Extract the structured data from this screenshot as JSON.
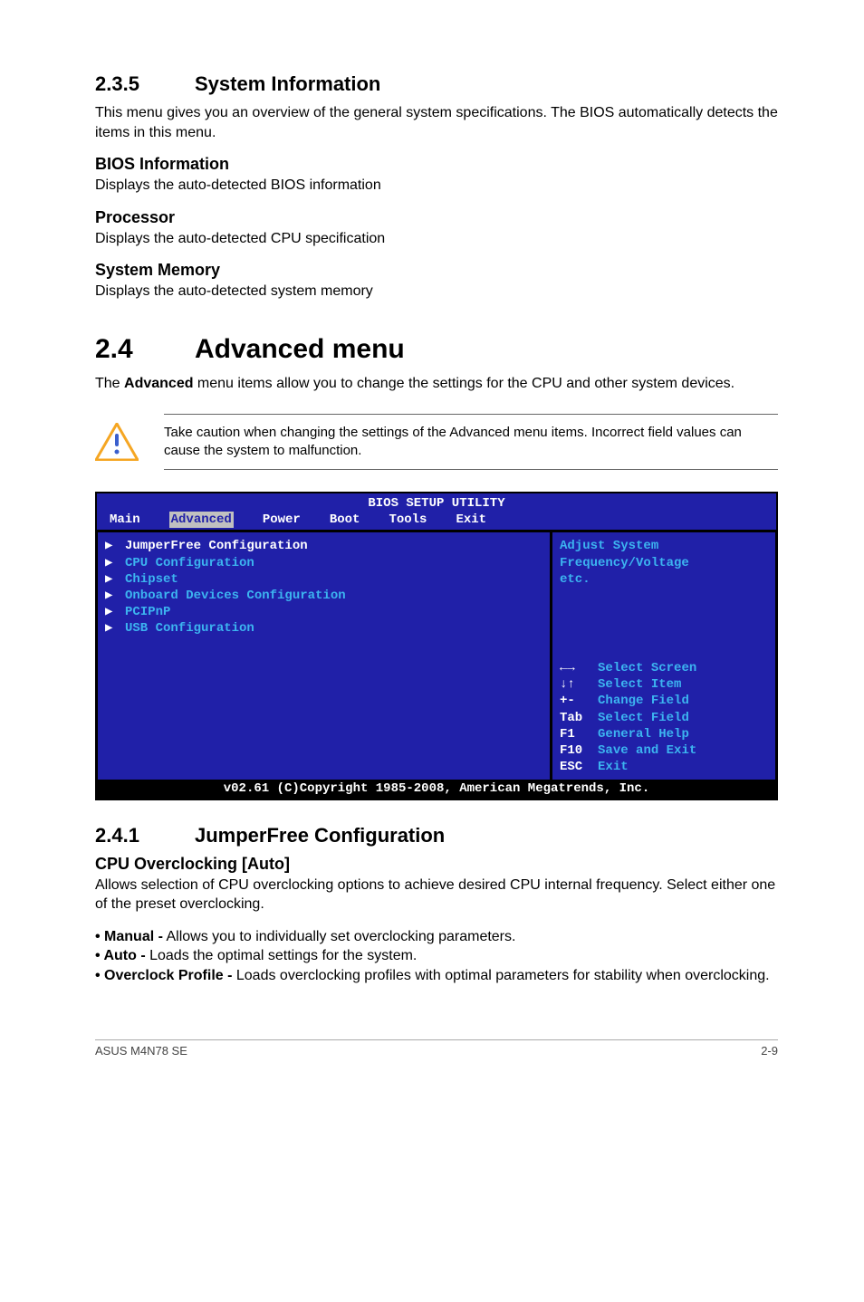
{
  "s235": {
    "num": "2.3.5",
    "title": "System Information",
    "intro": "This menu gives you an overview of the general system specifications. The BIOS automatically detects the items in this menu.",
    "bios_info_h": "BIOS Information",
    "bios_info_p": "Displays the auto-detected BIOS information",
    "proc_h": "Processor",
    "proc_p": "Displays the auto-detected CPU specification",
    "mem_h": "System Memory",
    "mem_p": "Displays the auto-detected system memory"
  },
  "s24": {
    "num": "2.4",
    "title": "Advanced menu",
    "intro_a": "The ",
    "intro_b": "Advanced",
    "intro_c": " menu items allow you to change the settings for the CPU and other system devices.",
    "note": "Take caution when changing the settings of the Advanced menu items. Incorrect field values can cause the system to malfunction."
  },
  "bios": {
    "title": "BIOS SETUP UTILITY",
    "tabs": {
      "main": "Main",
      "advanced": "Advanced",
      "power": "Power",
      "boot": "Boot",
      "tools": "Tools",
      "exit": "Exit"
    },
    "items": {
      "jumperfree": "JumperFree Configuration",
      "cpu": "CPU Configuration",
      "chipset": "Chipset",
      "onboard": "Onboard Devices Configuration",
      "pcipnp": "PCIPnP",
      "usb": "USB Configuration"
    },
    "help1": "Adjust System",
    "help2": "Frequency/Voltage",
    "help3": "etc.",
    "keys": {
      "k1s": "←→",
      "k1": "Select Screen",
      "k2s": "↓↑",
      "k2": "Select Item",
      "k3s": "+-",
      "k3": "Change Field",
      "k4s": "Tab",
      "k4": "Select Field",
      "k5s": "F1",
      "k5": "General Help",
      "k6s": "F10",
      "k6": "Save and Exit",
      "k7s": "ESC",
      "k7": "Exit"
    },
    "footer": "v02.61 (C)Copyright 1985-2008, American Megatrends, Inc."
  },
  "s241": {
    "num": "2.4.1",
    "title": "JumperFree Configuration",
    "cpu_h": "CPU Overclocking [Auto]",
    "cpu_p": "Allows selection of CPU overclocking options to achieve desired CPU internal frequency. Select either one of the preset overclocking.",
    "manual_b": "• Manual -",
    "manual_t": " Allows you to individually set overclocking parameters.",
    "auto_b": "• Auto -",
    "auto_t": " Loads the optimal settings for the system.",
    "over_b": "• Overclock Profile -",
    "over_t": " Loads overclocking profiles with optimal parameters for stability when overclocking."
  },
  "footer": {
    "left": "ASUS M4N78 SE",
    "right": "2-9"
  }
}
